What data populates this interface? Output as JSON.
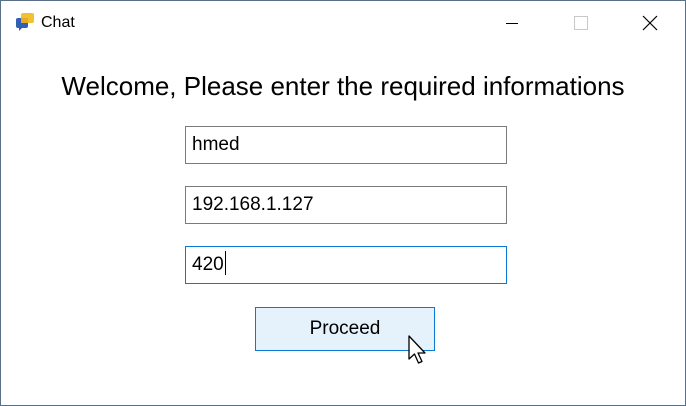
{
  "window": {
    "title": "Chat",
    "icon": "chat-app-icon",
    "controls": {
      "minimize_icon": "minimize-icon",
      "maximize_icon": "maximize-icon",
      "close_icon": "close-icon"
    }
  },
  "form": {
    "heading": "Welcome, Please enter the required informations",
    "fields": [
      {
        "name": "username",
        "value": "hmed"
      },
      {
        "name": "ip-address",
        "value": "192.168.1.127"
      },
      {
        "name": "port",
        "value": "420",
        "focused": true
      }
    ],
    "submit_label": "Proceed"
  },
  "colors": {
    "border": "#5a6f8a",
    "focus_accent": "#0a78d7",
    "button_background": "#e5f1fb",
    "field_border": "#7a7a7a"
  }
}
